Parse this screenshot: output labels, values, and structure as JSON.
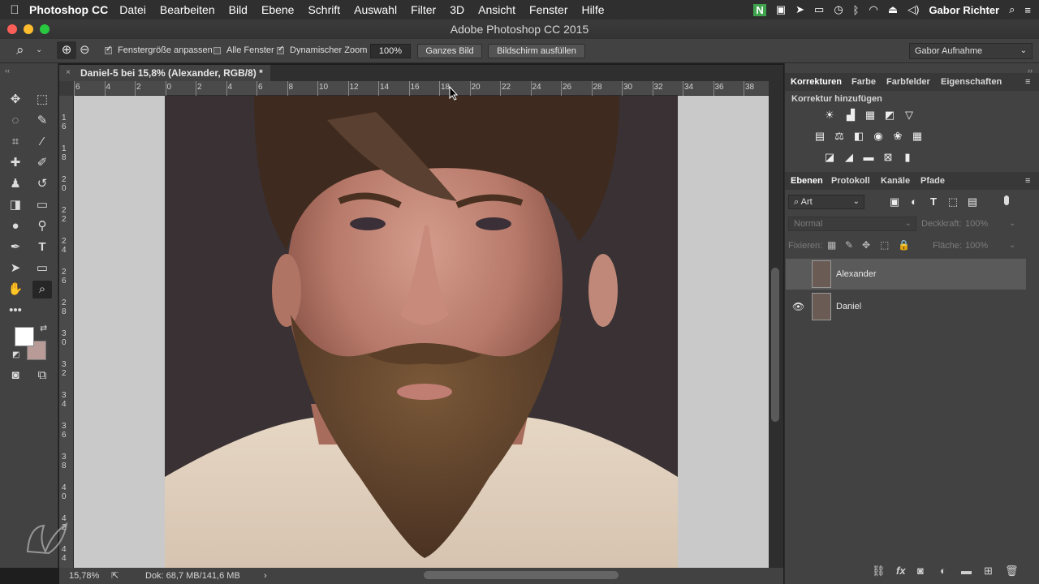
{
  "menubar": {
    "apple": "",
    "app": "Photoshop CC",
    "items": [
      "Datei",
      "Bearbeiten",
      "Bild",
      "Ebene",
      "Schrift",
      "Auswahl",
      "Filter",
      "3D",
      "Ansicht",
      "Fenster",
      "Hilfe"
    ],
    "user": "Gabor Richter"
  },
  "window": {
    "title": "Adobe Photoshop CC 2015"
  },
  "options": {
    "fit_window": "Fenstergröße anpassen",
    "all_windows": "Alle Fenster",
    "dynamic_zoom": "Dynamischer Zoom",
    "zoom_percent": "100%",
    "whole_image": "Ganzes Bild",
    "fill_screen": "Bildschirm ausfüllen",
    "workspace": "Gabor Aufnahme",
    "fit_window_checked": true,
    "all_windows_checked": false,
    "dynamic_zoom_checked": true
  },
  "document": {
    "tab_title": "Daniel-5 bei 15,8% (Alexander, RGB/8) *",
    "zoom_status": "15,78%",
    "doc_size": "Dok: 68,7 MB/141,6 MB"
  },
  "rulers": {
    "h_labels": [
      "6",
      "4",
      "2",
      "0",
      "2",
      "4",
      "6",
      "8",
      "10",
      "12",
      "14",
      "16",
      "18",
      "20",
      "22",
      "24",
      "26",
      "28",
      "30",
      "32",
      "34",
      "36",
      "38"
    ],
    "v_labels": [
      "1\n6",
      "1\n8",
      "2\n0",
      "2\n2",
      "2\n4",
      "2\n6",
      "2\n8",
      "3\n0",
      "3\n2",
      "3\n4",
      "3\n6",
      "3\n8",
      "4\n0",
      "4\n2",
      "4\n4"
    ]
  },
  "panels": {
    "top_tabs": [
      "Korrekturen",
      "Farbe",
      "Farbfelder",
      "Eigenschaften"
    ],
    "adjust_label": "Korrektur hinzufügen",
    "layer_tabs": [
      "Ebenen",
      "Protokoll",
      "Kanäle",
      "Pfade"
    ],
    "filter_kind": "Art",
    "blend_mode": "Normal",
    "opacity_label": "Deckkraft:",
    "opacity_value": "100%",
    "lock_label": "Fixieren:",
    "fill_label": "Fläche:",
    "fill_value": "100%",
    "layers": [
      {
        "name": "Alexander",
        "visible": false,
        "selected": true
      },
      {
        "name": "Daniel",
        "visible": true,
        "selected": false
      }
    ]
  },
  "colors": {
    "foreground": "#ffffff",
    "background": "#b89a96",
    "accent": "#2c7bd6"
  }
}
